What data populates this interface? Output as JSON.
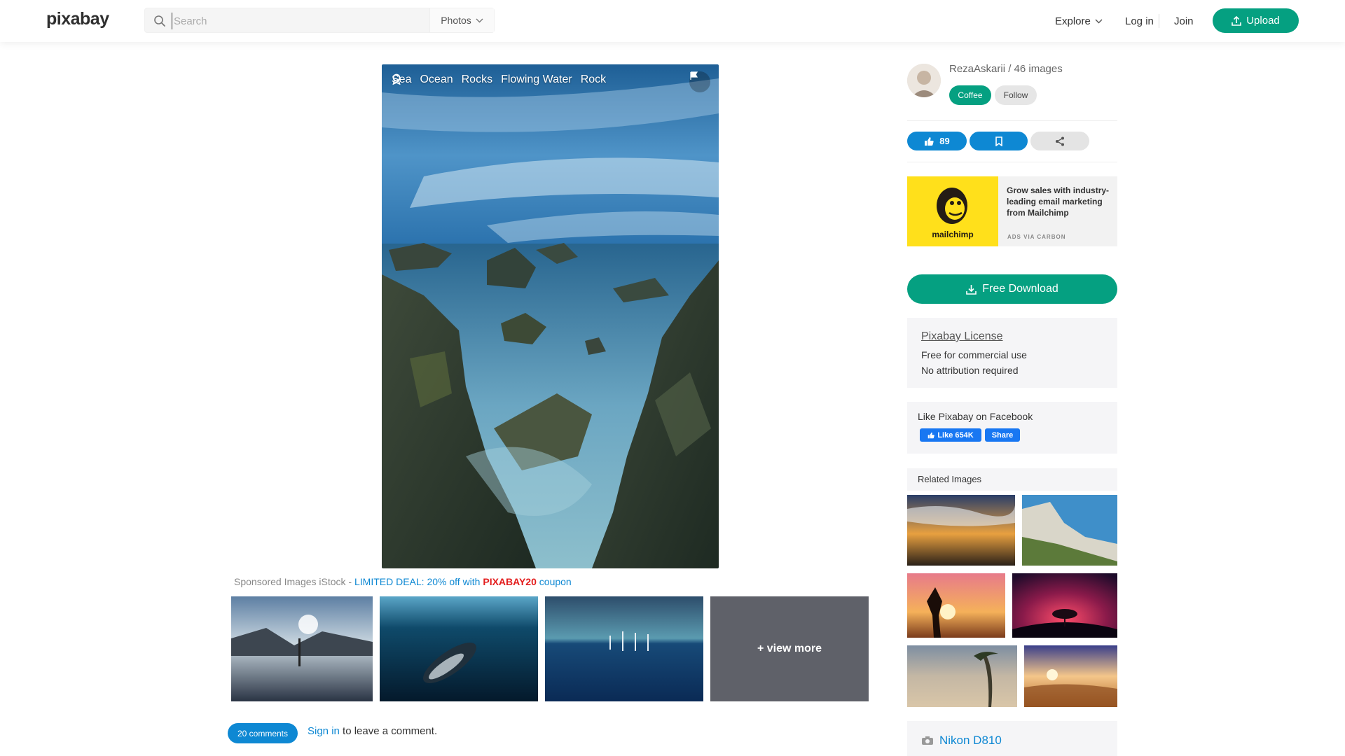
{
  "header": {
    "logo": "pixabay",
    "search_placeholder": "Search",
    "search_type": "Photos",
    "explore": "Explore",
    "login": "Log in",
    "join": "Join",
    "upload": "Upload"
  },
  "image": {
    "tags": [
      "Sea",
      "Ocean",
      "Rocks",
      "Flowing Water",
      "Rock"
    ]
  },
  "sponsored": {
    "prefix": "Sponsored Images iStock - ",
    "deal": "LIMITED DEAL: 20% off with ",
    "code": "PIXABAY20",
    "suffix": " coupon",
    "view_more": "+ view more"
  },
  "comments": {
    "count_label": "20 comments",
    "signin": "Sign in",
    "tail": " to leave a comment."
  },
  "author": {
    "line": "RezaAskarii / 46 images",
    "coffee": "Coffee",
    "follow": "Follow"
  },
  "actions": {
    "likes": "89"
  },
  "ad": {
    "brand": "mailchimp",
    "text": "Grow sales with industry-leading email marketing from Mailchimp",
    "via": "ADS VIA CARBON"
  },
  "download": {
    "label": "Free Download"
  },
  "license": {
    "title": "Pixabay License",
    "line1": "Free for commercial use",
    "line2": "No attribution required"
  },
  "facebook": {
    "title": "Like Pixabay on Facebook",
    "like": "Like 654K",
    "share": "Share"
  },
  "related": {
    "title": "Related Images"
  },
  "camera": {
    "model": "Nikon D810"
  },
  "colors": {
    "brand_green": "#05a081",
    "accent_blue": "#0e88d3",
    "coupon_red": "#e31d1d"
  }
}
